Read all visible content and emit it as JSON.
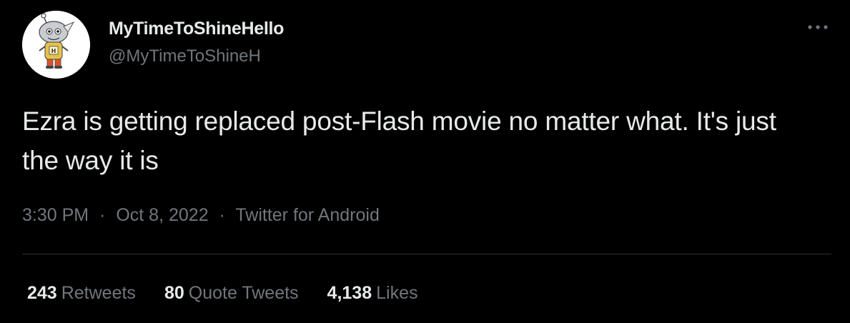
{
  "author": {
    "display_name": "MyTimeToShineHello",
    "handle": "@MyTimeToShineH",
    "avatar_icon": "cartoon-character-avatar-icon"
  },
  "more_icon": "more-options-icon",
  "tweet": {
    "text": "Ezra is getting replaced post-Flash movie no matter what. It's just the way it is"
  },
  "meta": {
    "time": "3:30 PM",
    "separator": "·",
    "date": "Oct 8, 2022",
    "source": "Twitter for Android"
  },
  "stats": {
    "retweets": {
      "count": "243",
      "label": "Retweets"
    },
    "quotes": {
      "count": "80",
      "label": "Quote Tweets"
    },
    "likes": {
      "count": "4,138",
      "label": "Likes"
    }
  },
  "colors": {
    "background": "#000000",
    "primary_text": "#e7e9ea",
    "secondary_text": "#71767b",
    "divider": "#2f3336"
  }
}
